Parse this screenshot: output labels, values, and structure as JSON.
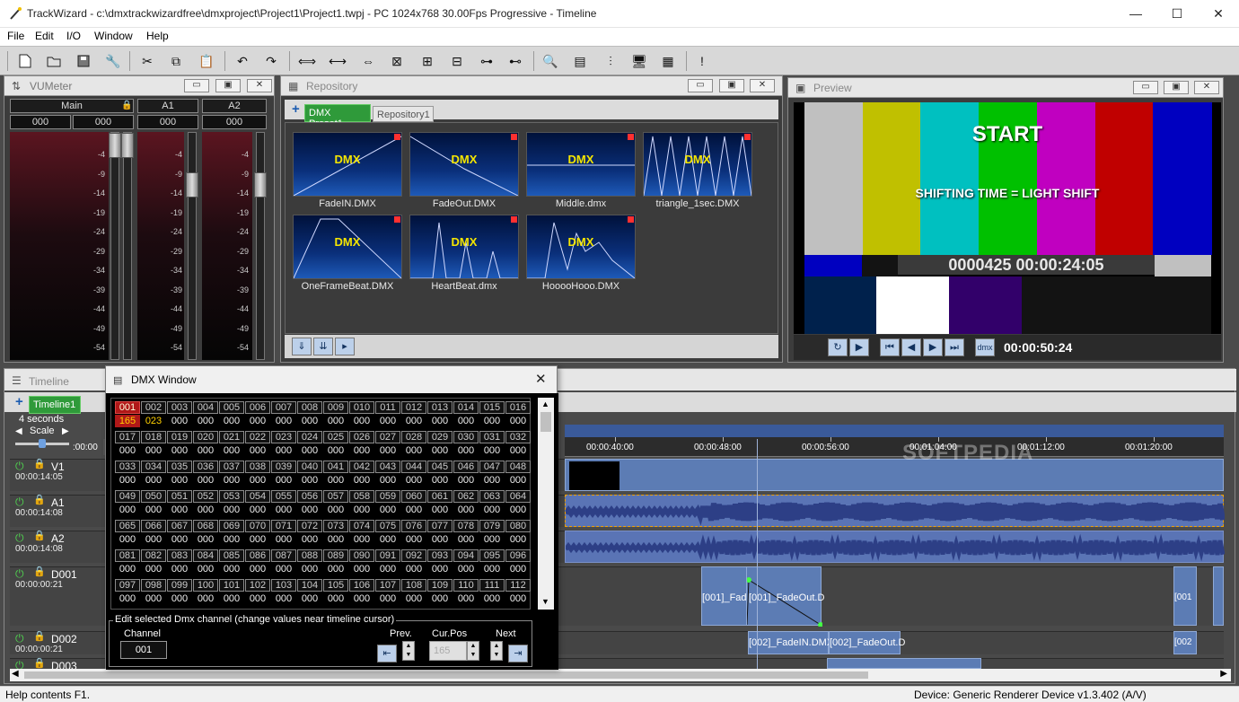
{
  "window": {
    "title": "TrackWizard - c:\\dmxtrackwizardfree\\dmxproject\\Project1\\Project1.twpj - PC 1024x768 30.00Fps Progressive - Timeline",
    "minimize": "—",
    "maximize": "☐",
    "close": "✕"
  },
  "menu": [
    "File",
    "Edit",
    "I/O",
    "Window",
    "Help"
  ],
  "toolbar_icons": [
    "new-file-icon",
    "open-folder-icon",
    "save-icon",
    "wrench-icon",
    "cut-icon",
    "copy-icon",
    "paste-icon",
    "undo-icon",
    "redo-icon",
    "fit-icon",
    "zoom-out-icon",
    "zoom-in-icon",
    "zoom-all-icon",
    "zoom-selection-a-icon",
    "zoom-selection-b-icon",
    "snap-icon",
    "snap-end-icon",
    "search-icon",
    "align-icon",
    "equalizer-icon",
    "monitor-icon",
    "grid-icon",
    "info-icon"
  ],
  "vumeter": {
    "title": "VUMeter",
    "channels": [
      {
        "name": "Main",
        "left": "000",
        "right": "000"
      },
      {
        "name": "A1",
        "value": "000"
      },
      {
        "name": "A2",
        "value": "000"
      }
    ],
    "scale": [
      "-4",
      "-9",
      "-14",
      "-19",
      "-24",
      "-29",
      "-34",
      "-39",
      "-44",
      "-49",
      "-54"
    ]
  },
  "repository": {
    "title": "Repository",
    "tabs": [
      "DMX Preset1",
      "Repository1"
    ],
    "items": [
      {
        "label": "FadeIN.DMX",
        "thumb": "DMX"
      },
      {
        "label": "FadeOut.DMX",
        "thumb": "DMX"
      },
      {
        "label": "Middle.dmx",
        "thumb": "DMX"
      },
      {
        "label": "triangle_1sec.DMX",
        "thumb": "DMX"
      },
      {
        "label": "OneFrameBeat.DMX",
        "thumb": "DMX"
      },
      {
        "label": "HeartBeat.dmx",
        "thumb": "DMX"
      },
      {
        "label": "HooooHooo.DMX",
        "thumb": "DMX"
      }
    ]
  },
  "preview": {
    "title": "Preview",
    "overlay_title": "START",
    "overlay_sub": "SHIFTING TIME = LIGHT SHIFT",
    "overlay_tc": "0000425 00:00:24:05",
    "dmx_btn": "dmx",
    "time": "00:00:50:24",
    "colors": [
      "#c0c0c0",
      "#c0c000",
      "#00c0c0",
      "#00c000",
      "#c000c0",
      "#c00000",
      "#0000c0"
    ]
  },
  "timeline": {
    "title": "Timeline",
    "tab": "Timeline1",
    "zoom_label": "4 seconds",
    "scale_label": "Scale",
    "ruler_start": ":00:00",
    "ruler": [
      "00:00:40:00",
      "00:00:48:00",
      "00:00:56:00",
      "00:01:04:00",
      "00:01:12:00",
      "00:01:20:00"
    ],
    "tracks": [
      {
        "name": "V1",
        "time": "00:00:14:05"
      },
      {
        "name": "A1",
        "time": "00:00:14:08"
      },
      {
        "name": "A2",
        "time": "00:00:14:08"
      },
      {
        "name": "D001",
        "time": "00:00:00:21"
      },
      {
        "name": "D002",
        "time": "00:00:00:21"
      },
      {
        "name": "D003",
        "time": ""
      }
    ],
    "clips": {
      "d001a": "[001]_Fad",
      "d001b": "[001]_FadeOut.D",
      "d001c": "[001",
      "d002a": "[002]_FadeIN.DMX",
      "d002b": "[002]_FadeOut.D",
      "d002c": "[002"
    },
    "watermark": "SOFTPEDIA"
  },
  "dmx_window": {
    "title": "DMX Window",
    "close": "✕",
    "selected_value": "165",
    "ch2_value": "023",
    "edit_group": "Edit selected Dmx channel (change values near timeline cursor)",
    "channel_label": "Channel",
    "channel_value": "001",
    "prev_label": "Prev.",
    "curpos_label": "Cur.Pos",
    "curpos_value": "165",
    "next_label": "Next"
  },
  "statusbar": {
    "help": "Help contents  F1.",
    "device": "Device: Generic Renderer Device v1.3.402 (A/V)"
  }
}
